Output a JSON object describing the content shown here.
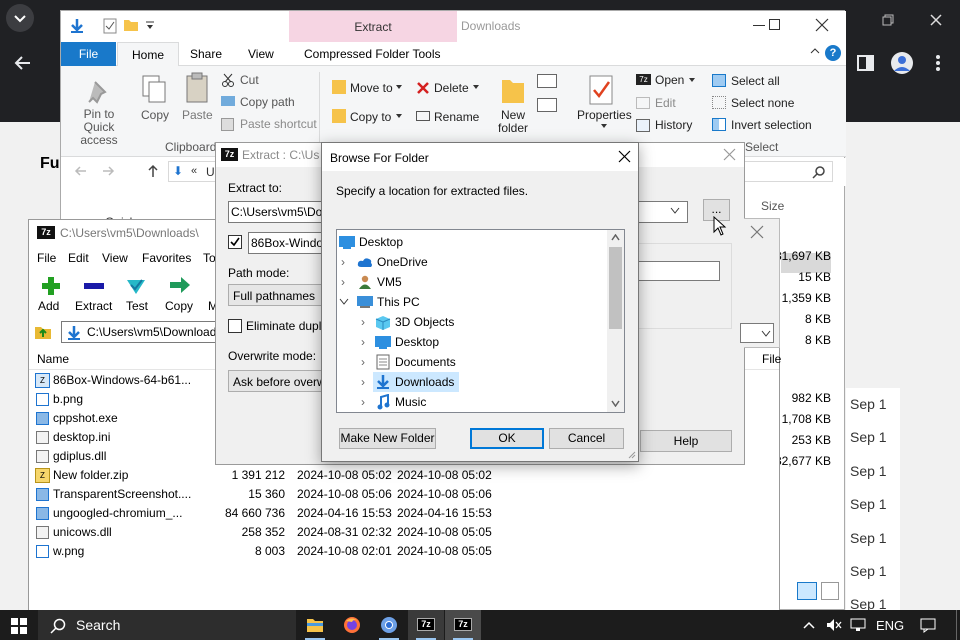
{
  "explorer": {
    "tabs": [
      "File",
      "Home",
      "Share",
      "View",
      "Compressed Folder Tools"
    ],
    "context_tab": "Extract",
    "title": "Downloads",
    "clipboard": {
      "pin": "Pin to Quick access",
      "copy": "Copy",
      "paste": "Paste",
      "cut": "Cut",
      "copy_path": "Copy path",
      "paste_shortcut": "Paste shortcut",
      "group": "Clipboard"
    },
    "organize": {
      "move_to": "Move to",
      "copy_to": "Copy to",
      "delete": "Delete",
      "rename": "Rename"
    },
    "new": {
      "new_folder": "New folder"
    },
    "open": {
      "properties": "Properties",
      "open": "Open",
      "edit": "Edit",
      "history": "History"
    },
    "select": {
      "select_all": "Select all",
      "select_none": "Select none",
      "invert": "Invert selection",
      "group": "Select"
    },
    "address_stub": "Us",
    "size_header": "Size",
    "sizes": [
      "31,697 KB",
      "15 KB",
      "1,359 KB",
      "8 KB",
      "8 KB",
      "982 KB",
      "1,708 KB",
      "253 KB",
      "32,677 KB"
    ],
    "dates": [
      "Sep 1",
      "Sep 1",
      "Sep 1",
      "Sep 1",
      "Sep 1",
      "Sep 1",
      "Sep 1"
    ],
    "partial_title": "Fu",
    "quick": "Quick"
  },
  "fm": {
    "title": "C:\\Users\\vm5\\Downloads\\",
    "menu": [
      "File",
      "Edit",
      "View",
      "Favorites",
      "To"
    ],
    "toolbar": [
      "Add",
      "Extract",
      "Test",
      "Copy",
      "M"
    ],
    "address": "C:\\Users\\vm5\\Download",
    "col_name": "Name",
    "col_file": "File",
    "files": [
      {
        "name": "86Box-Windows-64-b61...",
        "size": "",
        "modified": "",
        "created": ""
      },
      {
        "name": "b.png",
        "size": "",
        "modified": "",
        "created": ""
      },
      {
        "name": "cppshot.exe",
        "size": "",
        "modified": "",
        "created": ""
      },
      {
        "name": "desktop.ini",
        "size": "",
        "modified": "",
        "created": ""
      },
      {
        "name": "gdiplus.dll",
        "size": "",
        "modified": "",
        "created": ""
      },
      {
        "name": "New folder.zip",
        "size": "1 391 212",
        "modified": "2024-10-08 05:02",
        "created": "2024-10-08 05:02"
      },
      {
        "name": "TransparentScreenshot....",
        "size": "15 360",
        "modified": "2024-10-08 05:06",
        "created": "2024-10-08 05:06"
      },
      {
        "name": "ungoogled-chromium_...",
        "size": "84 660 736",
        "modified": "2024-04-16 15:53",
        "created": "2024-04-16 15:53"
      },
      {
        "name": "unicows.dll",
        "size": "258 352",
        "modified": "2024-08-31 02:32",
        "created": "2024-10-08 05:05"
      },
      {
        "name": "w.png",
        "size": "8 003",
        "modified": "2024-10-08 02:01",
        "created": "2024-10-08 05:05"
      }
    ]
  },
  "extract": {
    "title": "Extract : C:\\Us",
    "extract_to_label": "Extract to:",
    "extract_to_value": "C:\\Users\\vm5\\Dow",
    "browse_btn": "...",
    "folder_name": "86Box-Window",
    "path_mode_label": "Path mode:",
    "path_mode_value": "Full pathnames",
    "eliminate": "Eliminate duplica",
    "overwrite_label": "Overwrite mode:",
    "overwrite_value": "Ask before overwri",
    "help": "Help"
  },
  "browse": {
    "title": "Browse For Folder",
    "instruction": "Specify a location for extracted files.",
    "tree": [
      {
        "label": "Desktop",
        "icon": "desktop-icon",
        "indent": 0,
        "expander": ""
      },
      {
        "label": "OneDrive",
        "icon": "cloud-icon",
        "indent": 1,
        "expander": ">"
      },
      {
        "label": "VM5",
        "icon": "user-icon",
        "indent": 1,
        "expander": ">"
      },
      {
        "label": "This PC",
        "icon": "pc-icon",
        "indent": 1,
        "expander": "v"
      },
      {
        "label": "3D Objects",
        "icon": "cube-icon",
        "indent": 2,
        "expander": ">"
      },
      {
        "label": "Desktop",
        "icon": "desktop-icon",
        "indent": 2,
        "expander": ">"
      },
      {
        "label": "Documents",
        "icon": "document-icon",
        "indent": 2,
        "expander": ">"
      },
      {
        "label": "Downloads",
        "icon": "download-icon",
        "indent": 2,
        "expander": ">",
        "selected": true
      },
      {
        "label": "Music",
        "icon": "music-icon",
        "indent": 2,
        "expander": ">"
      }
    ],
    "make_new_folder": "Make New Folder",
    "ok": "OK",
    "cancel": "Cancel"
  },
  "taskbar": {
    "search": "Search",
    "lang": "ENG"
  },
  "colors": {
    "accent": "#0078d7",
    "chrome_bg": "#202124",
    "taskbar_bg": "#1c1c1c",
    "extract_tab": "#f6d5e3",
    "selection": "#cce8ff"
  }
}
